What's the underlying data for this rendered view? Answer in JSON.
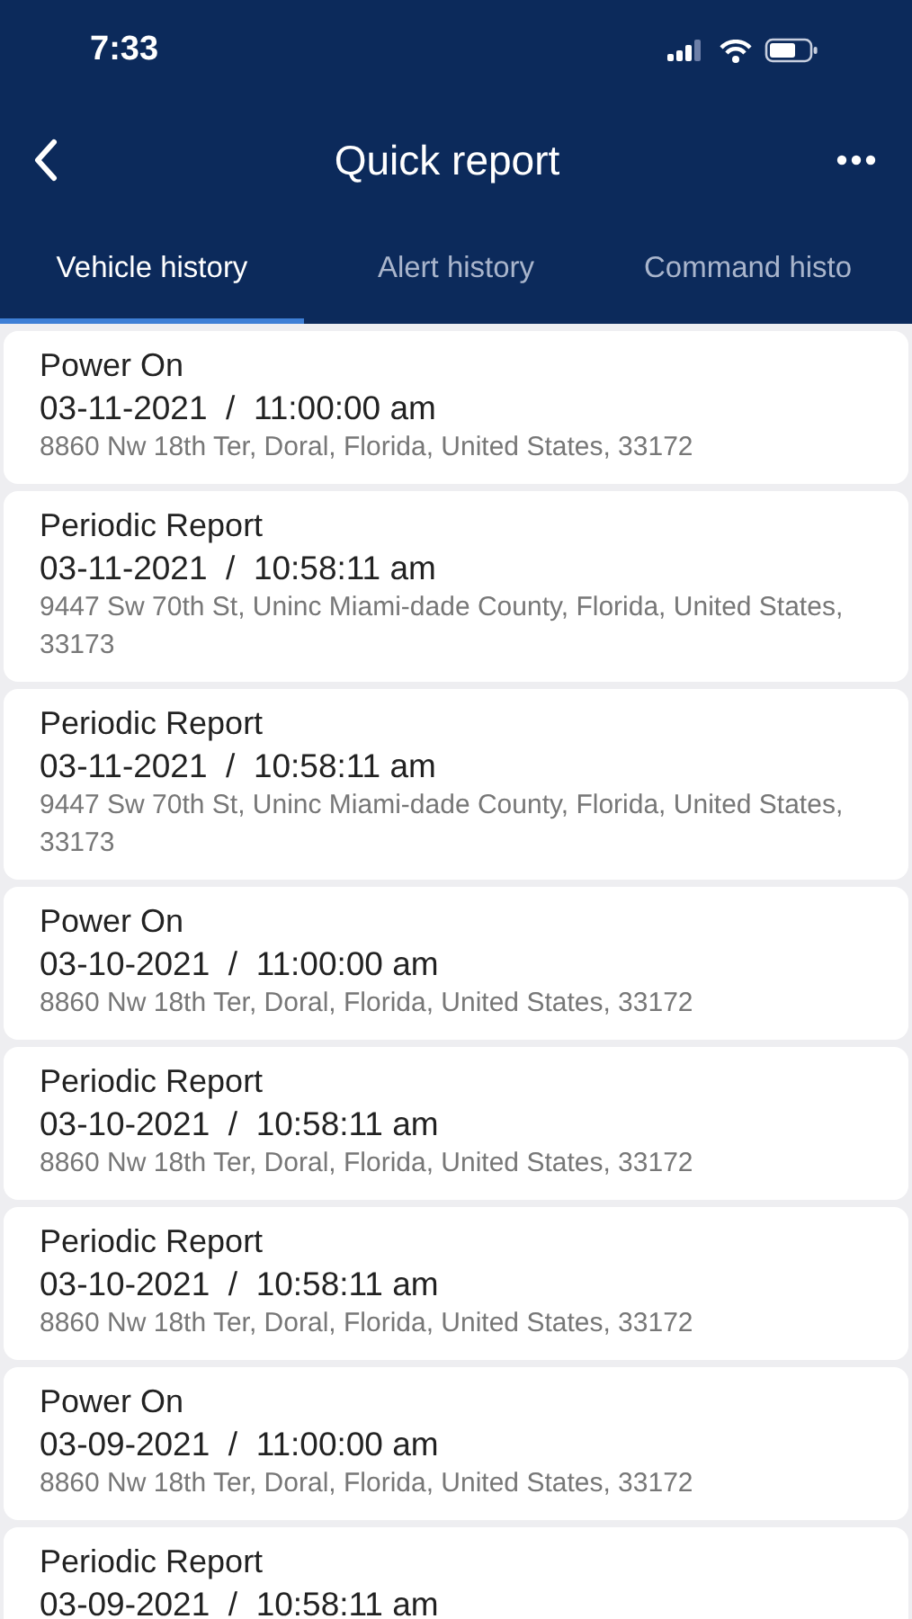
{
  "status_bar": {
    "time": "7:33"
  },
  "header": {
    "title": "Quick report"
  },
  "tabs": [
    {
      "label": "Vehicle history",
      "selected": true
    },
    {
      "label": "Alert history",
      "selected": false
    },
    {
      "label": "Command histo",
      "selected": false
    }
  ],
  "events": [
    {
      "type": "Power On",
      "datetime": "03-11-2021  /  11:00:00 am",
      "address": "8860 Nw 18th Ter, Doral, Florida, United States, 33172"
    },
    {
      "type": "Periodic Report",
      "datetime": "03-11-2021  /  10:58:11 am",
      "address": "9447 Sw 70th St, Uninc Miami-dade County, Florida, United States, 33173"
    },
    {
      "type": "Periodic Report",
      "datetime": "03-11-2021  /  10:58:11 am",
      "address": "9447 Sw 70th St, Uninc Miami-dade County, Florida, United States, 33173"
    },
    {
      "type": "Power On",
      "datetime": "03-10-2021  /  11:00:00 am",
      "address": "8860 Nw 18th Ter, Doral, Florida, United States, 33172"
    },
    {
      "type": "Periodic Report",
      "datetime": "03-10-2021  /  10:58:11 am",
      "address": "8860 Nw 18th Ter, Doral, Florida, United States, 33172"
    },
    {
      "type": "Periodic Report",
      "datetime": "03-10-2021  /  10:58:11 am",
      "address": "8860 Nw 18th Ter, Doral, Florida, United States, 33172"
    },
    {
      "type": "Power On",
      "datetime": "03-09-2021  /  11:00:00 am",
      "address": "8860 Nw 18th Ter, Doral, Florida, United States, 33172"
    },
    {
      "type": "Periodic Report",
      "datetime": "03-09-2021  /  10:58:11 am"
    }
  ]
}
